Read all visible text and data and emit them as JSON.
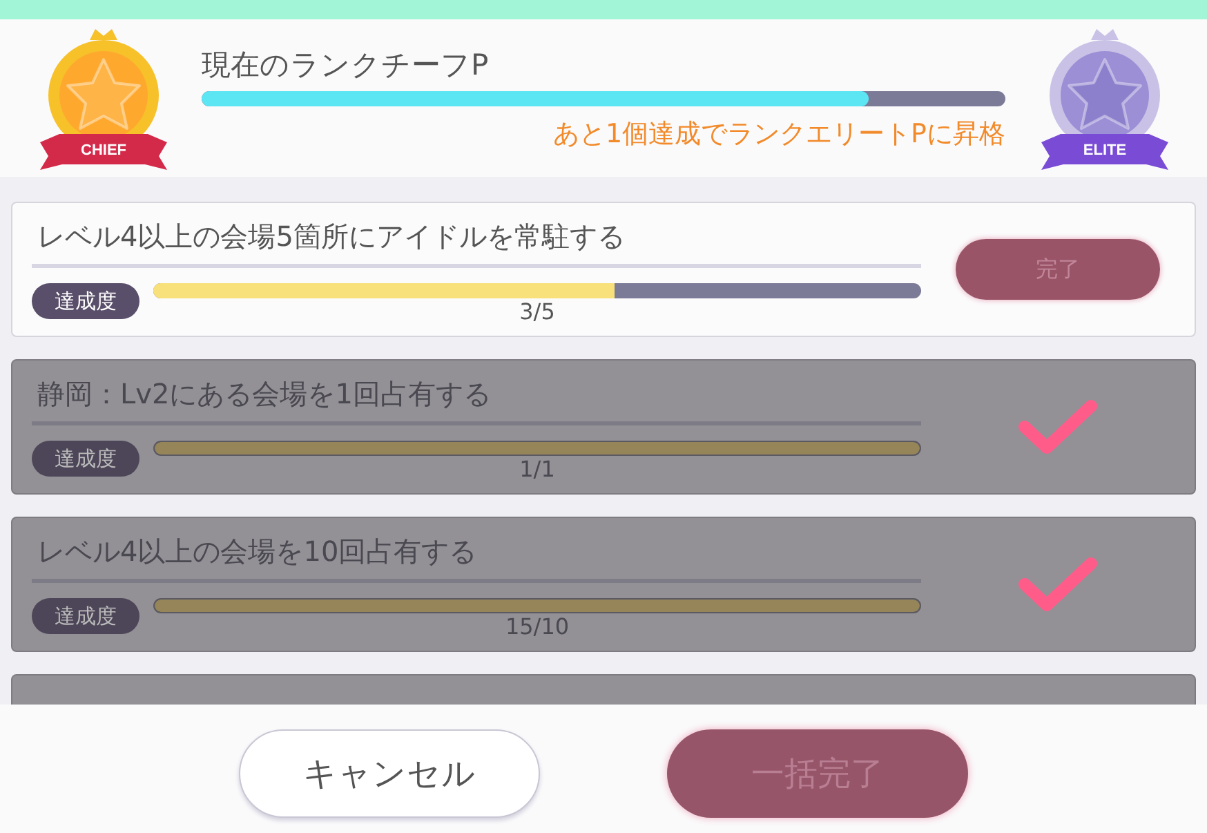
{
  "header": {
    "current_rank": "現在のランクチーフP",
    "rank_progress": {
      "level": 0.83
    },
    "promotion_note": "あと1個達成でランクエリートPに昇格",
    "current_badge": "CHIEF",
    "next_badge": "ELITE"
  },
  "missions": [
    {
      "title": "レベル4以上の会場5箇所にアイドルを常駐する",
      "badge": "達成度",
      "level": 0.6,
      "reading": "3/5",
      "completed": false,
      "button": "完了"
    },
    {
      "title": "静岡：Lv2にある会場を1回占有する",
      "badge": "達成度",
      "level": 1,
      "reading": "1/1",
      "completed": true
    },
    {
      "title": "レベル4以上の会場を10回占有する",
      "badge": "達成度",
      "level": 1,
      "reading": "15/10",
      "completed": true
    },
    {
      "kind": "cut_off",
      "completed": true
    }
  ],
  "buttons": [
    {
      "label": "キャンセル",
      "kind": "cancel"
    },
    {
      "label": "一括完了",
      "kind": "confirm"
    }
  ]
}
